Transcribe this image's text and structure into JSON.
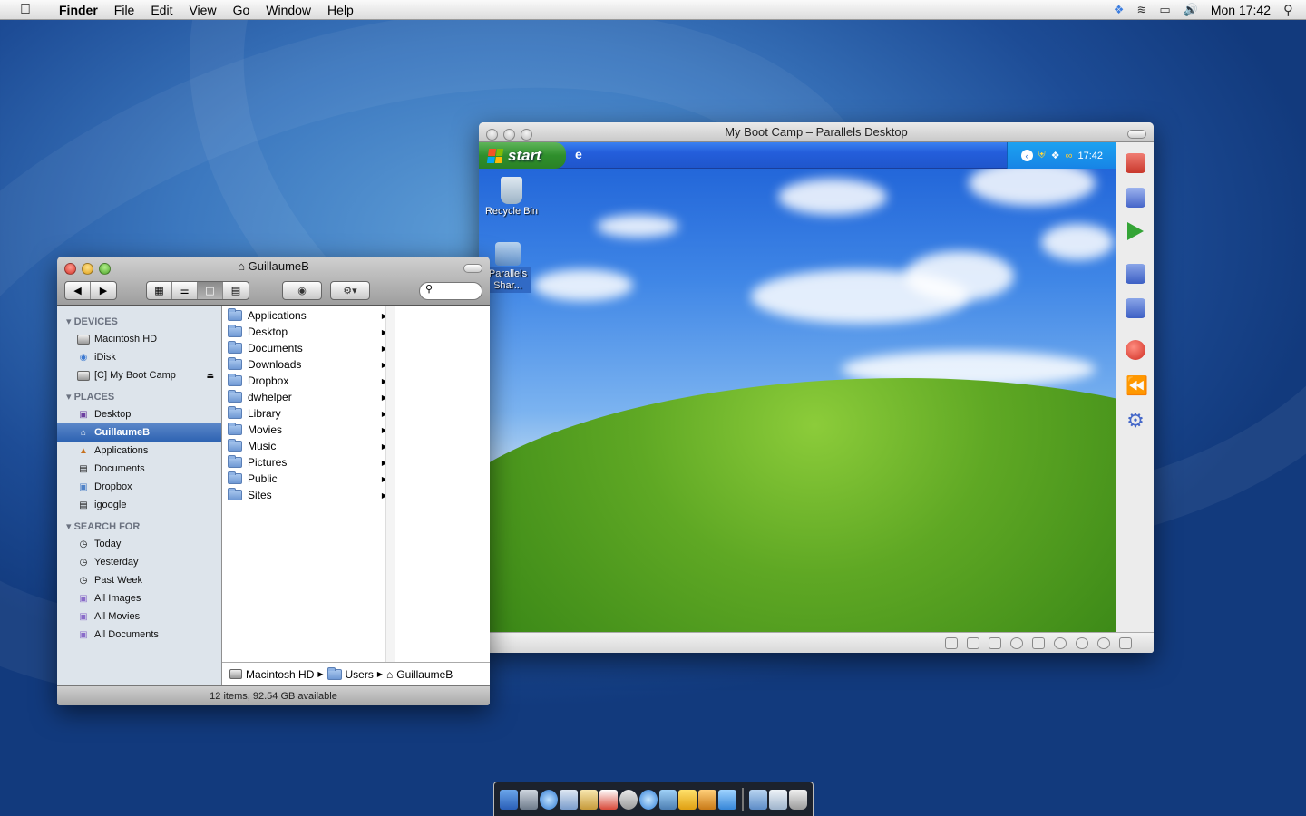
{
  "menubar": {
    "apple": "",
    "app": "Finder",
    "items": [
      "File",
      "Edit",
      "View",
      "Go",
      "Window",
      "Help"
    ],
    "clock": "Mon 17:42",
    "status_icons": [
      "dropbox-icon",
      "wifi-icon",
      "battery-icon",
      "volume-icon",
      "spotlight-icon"
    ]
  },
  "finder": {
    "title": "GuillaumeB",
    "search_placeholder": "",
    "sidebar": {
      "devices_heading": "DEVICES",
      "devices": [
        "Macintosh HD",
        "iDisk",
        "[C] My Boot Camp"
      ],
      "places_heading": "PLACES",
      "places": [
        "Desktop",
        "GuillaumeB",
        "Applications",
        "Documents",
        "Dropbox",
        "igoogle"
      ],
      "selected": "GuillaumeB",
      "search_heading": "SEARCH FOR",
      "searches": [
        "Today",
        "Yesterday",
        "Past Week",
        "All Images",
        "All Movies",
        "All Documents"
      ]
    },
    "columns": [
      [
        "Applications",
        "Desktop",
        "Documents",
        "Downloads",
        "Dropbox",
        "dwhelper",
        "Library",
        "Movies",
        "Music",
        "Pictures",
        "Public",
        "Sites"
      ]
    ],
    "path": [
      "Macintosh HD",
      "Users",
      "GuillaumeB"
    ],
    "status": "12 items, 92.54 GB available"
  },
  "parallels": {
    "title": "My Boot Camp – Parallels Desktop",
    "xp": {
      "start_label": "start",
      "clock": "17:42",
      "icons": [
        {
          "label": "Recycle Bin"
        },
        {
          "label": "Parallels Shar..."
        }
      ]
    }
  }
}
